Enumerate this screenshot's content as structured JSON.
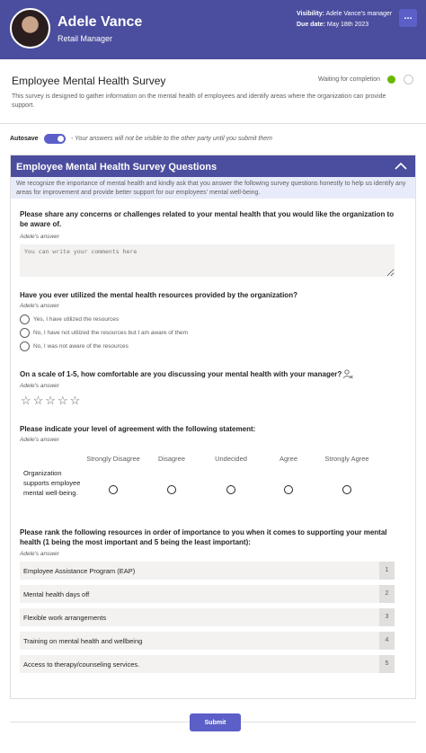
{
  "header": {
    "name": "Adele Vance",
    "role": "Retail Manager",
    "visibility_label": "Visibility:",
    "visibility_value": "Adele Vance's manager",
    "due_label": "Due date:",
    "due_value": "May 18th 2023",
    "more_label": "..."
  },
  "survey": {
    "title": "Employee Mental Health Survey",
    "status": "Waiting for completion",
    "description": "This survey is designed to gather information on the mental health of employees and identify areas where the organization can provide support."
  },
  "autosave": {
    "label": "Autosave",
    "note": "- Your answers will not be visible to the other party until you submit them"
  },
  "section": {
    "title": "Employee Mental Health Survey Questions",
    "intro": "We recognize the importance of mental health and kindly ask that you answer the following survey questions honestly to help us identify any areas for improvement and provide better support for our employees' mental well-being."
  },
  "answer_label": "Adele's answer",
  "q1": {
    "text": "Please share any concerns or challenges related to your mental health that you would like the organization to be aware of.",
    "placeholder": "You can write your comments here"
  },
  "q2": {
    "text": "Have you ever utilized the mental health resources provided by the organization?",
    "options": [
      "Yes, I have utilized the resources",
      "No, I have not utilized the resources but I am aware of them",
      "No, I was not aware of the resources"
    ]
  },
  "q3": {
    "text": "On a scale of 1-5, how comfortable are you discussing your mental health with your manager?",
    "stars": "☆☆☆☆☆",
    "rating": 0,
    "max_rating": 5
  },
  "q4": {
    "text": "Please indicate your level of agreement with the following statement:",
    "scale": [
      "Strongly Disagree",
      "Disagree",
      "Undecided",
      "Agree",
      "Strongly Agree"
    ],
    "statement": "Organization supports employee mental well-being."
  },
  "q5": {
    "text": "Please rank the following resources in order of importance to you when it comes to supporting your mental health (1 being the most important and 5 being the least important):",
    "items": [
      {
        "label": "Employee Assistance Program (EAP)",
        "rank": "1"
      },
      {
        "label": "Mental health days off",
        "rank": "2"
      },
      {
        "label": "Flexible work arrangements",
        "rank": "3"
      },
      {
        "label": "Training on mental health and wellbeing",
        "rank": "4"
      },
      {
        "label": "Access to therapy/counseling services.",
        "rank": "5"
      }
    ]
  },
  "submit_label": "Submit",
  "colors": {
    "brand": "#4b4d9e",
    "accent": "#5b5fc7",
    "status_green": "#6bb700",
    "intro_bg": "#e8ebfa"
  }
}
